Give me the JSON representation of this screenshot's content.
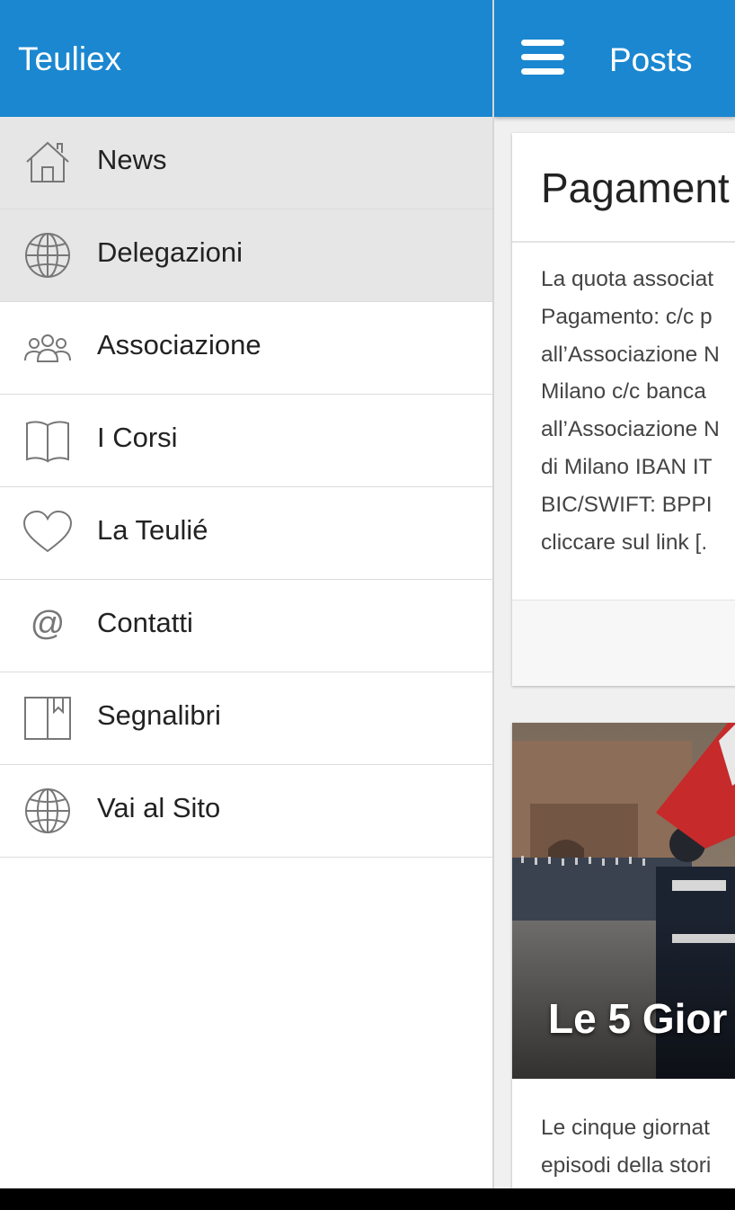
{
  "sidebar": {
    "title": "Teuliex",
    "items": [
      {
        "label": "News",
        "icon": "home-icon",
        "active": true
      },
      {
        "label": "Delegazioni",
        "icon": "globe-icon",
        "active": true
      },
      {
        "label": "Associazione",
        "icon": "group-icon",
        "active": false
      },
      {
        "label": "I Corsi",
        "icon": "book-icon",
        "active": false
      },
      {
        "label": "La Teulié",
        "icon": "heart-icon",
        "active": false
      },
      {
        "label": "Contatti",
        "icon": "at-icon",
        "active": false
      },
      {
        "label": "Segnalibri",
        "icon": "bookmark-icon",
        "active": false
      },
      {
        "label": "Vai al Sito",
        "icon": "globe-icon",
        "active": false
      }
    ]
  },
  "topbar": {
    "menu_icon": "hamburger-icon",
    "title": "Posts"
  },
  "posts": [
    {
      "title": "Pagament",
      "lines": [
        "La quota associat",
        "Pagamento: c/c p",
        "all’Associazione N",
        "Milano   c/c banca",
        "all’Associazione N",
        "di Milano IBAN IT",
        "BIC/SWIFT: BPPI",
        "cliccare sul link [."
      ]
    },
    {
      "image_caption": "Le 5 Gior",
      "lines": [
        "Le cinque giornat",
        "episodi della stori"
      ]
    }
  ],
  "colors": {
    "primary": "#1a87d0",
    "active_item": "#e6e6e6",
    "icon": "#777777"
  }
}
